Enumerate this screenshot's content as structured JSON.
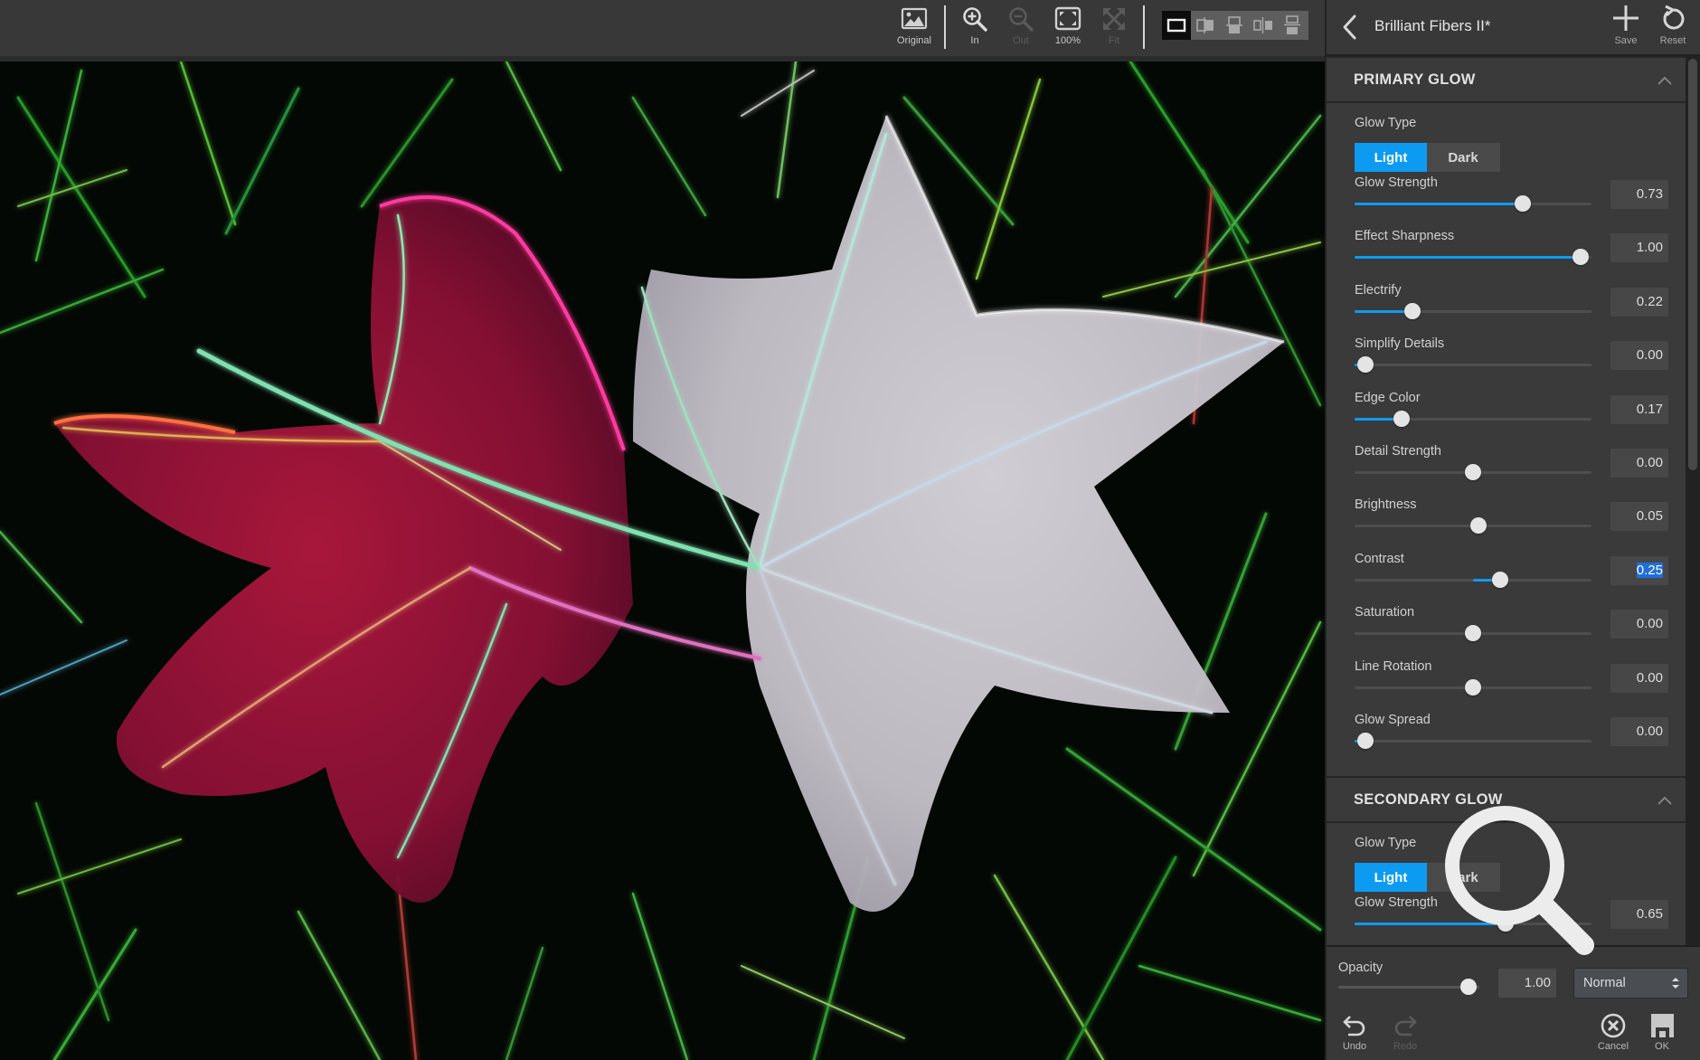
{
  "toolbar": {
    "buttons": [
      {
        "label": "Original",
        "icon": "image-icon",
        "enabled": true
      },
      {
        "label": "In",
        "icon": "zoom-in-icon",
        "enabled": true
      },
      {
        "label": "Out",
        "icon": "zoom-out-icon",
        "enabled": false
      },
      {
        "label": "100%",
        "icon": "actual-size-icon",
        "enabled": true
      },
      {
        "label": "Fit",
        "icon": "fit-icon",
        "enabled": false
      }
    ],
    "view_modes": [
      {
        "name": "single",
        "active": true
      },
      {
        "name": "split-vertical",
        "active": false
      },
      {
        "name": "split-horizontal",
        "active": false
      },
      {
        "name": "side-by-side",
        "active": false
      },
      {
        "name": "top-bottom",
        "active": false
      }
    ]
  },
  "panel": {
    "preset_title": "Brilliant Fibers II*",
    "save_label": "Save",
    "reset_label": "Reset",
    "sections": [
      {
        "title": "PRIMARY GLOW",
        "glow_type_label": "Glow Type",
        "glow_type_options": [
          "Light",
          "Dark"
        ],
        "glow_type_selected": "Light",
        "sliders": [
          {
            "label": "Glow Strength",
            "value": "0.73",
            "min": 0,
            "max": 1,
            "bipolar": false
          },
          {
            "label": "Effect Sharpness",
            "value": "1.00",
            "min": 0,
            "max": 1,
            "bipolar": false
          },
          {
            "label": "Electrify",
            "value": "0.22",
            "min": 0,
            "max": 1,
            "bipolar": false
          },
          {
            "label": "Simplify Details",
            "value": "0.00",
            "min": 0,
            "max": 1,
            "bipolar": false
          },
          {
            "label": "Edge Color",
            "value": "0.17",
            "min": 0,
            "max": 1,
            "bipolar": false
          },
          {
            "label": "Detail Strength",
            "value": "0.00",
            "min": -1,
            "max": 1,
            "bipolar": true
          },
          {
            "label": "Brightness",
            "value": "0.05",
            "min": -1,
            "max": 1,
            "bipolar": true
          },
          {
            "label": "Contrast",
            "value": "0.25",
            "min": -1,
            "max": 1,
            "bipolar": true,
            "selected": true
          },
          {
            "label": "Saturation",
            "value": "0.00",
            "min": -1,
            "max": 1,
            "bipolar": true
          },
          {
            "label": "Line Rotation",
            "value": "0.00",
            "min": -1,
            "max": 1,
            "bipolar": true
          },
          {
            "label": "Glow Spread",
            "value": "0.00",
            "min": 0,
            "max": 1,
            "bipolar": false
          }
        ]
      },
      {
        "title": "SECONDARY GLOW",
        "glow_type_label": "Glow Type",
        "glow_type_options": [
          "Light",
          "Dark"
        ],
        "glow_type_selected": "Light",
        "sliders": [
          {
            "label": "Glow Strength",
            "value": "0.65",
            "min": 0,
            "max": 1,
            "bipolar": false
          }
        ]
      }
    ]
  },
  "bottom": {
    "opacity_label": "Opacity",
    "opacity_value": "1.00",
    "blend_mode": "Normal",
    "undo_label": "Undo",
    "redo_label": "Redo",
    "cancel_label": "Cancel",
    "ok_label": "OK"
  },
  "colors": {
    "accent": "#0d9bf2",
    "panel_bg": "#3a3a3a",
    "toolbar_bg": "#383838"
  }
}
